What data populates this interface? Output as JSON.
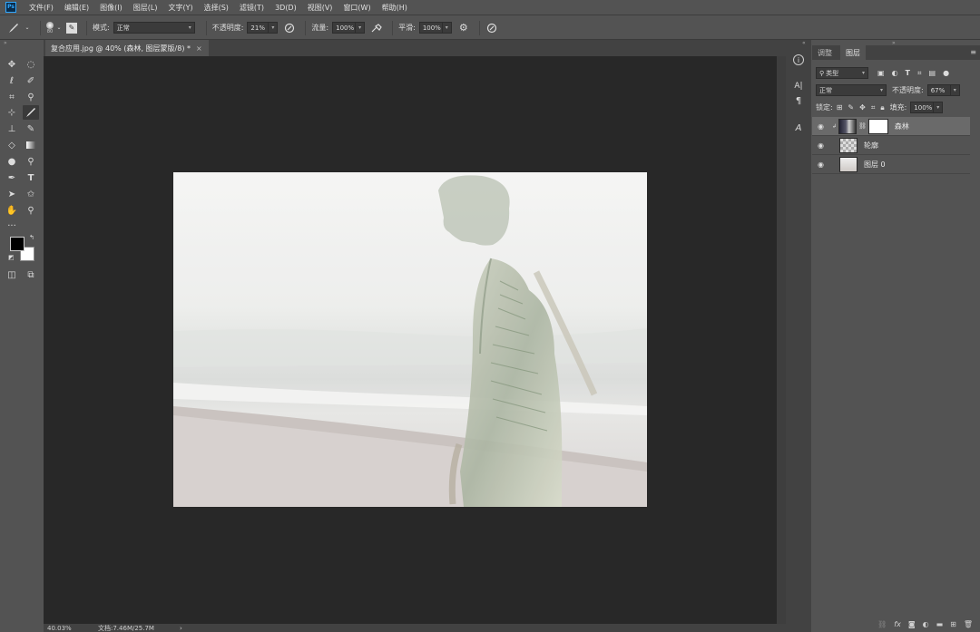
{
  "app": {
    "logo": "Ps"
  },
  "menu": [
    "文件(F)",
    "编辑(E)",
    "图像(I)",
    "图层(L)",
    "文字(Y)",
    "选择(S)",
    "滤镜(T)",
    "3D(D)",
    "视图(V)",
    "窗口(W)",
    "帮助(H)"
  ],
  "options": {
    "brush_size": "80",
    "mode_label": "模式:",
    "mode_value": "正常",
    "opacity_label": "不透明度:",
    "opacity_value": "21%",
    "flow_label": "流量:",
    "flow_value": "100%",
    "smooth_label": "平滑:",
    "smooth_value": "100%"
  },
  "document": {
    "tab_title": "复合应用.jpg @ 40% (森林, 图层蒙版/8) *",
    "close": "×"
  },
  "status": {
    "zoom": "40.03%",
    "doc_info": "文档:7.46M/25.7M",
    "arrow": "›"
  },
  "panels": {
    "tabs": [
      "调整",
      "图层"
    ],
    "active_tab": "图层",
    "filter_kind": "类型",
    "blend_mode": "正常",
    "opacity_label": "不透明度:",
    "opacity_value": "67%",
    "lock_label": "锁定:",
    "fill_label": "填充:",
    "fill_value": "100%",
    "layers": [
      {
        "name": "森林",
        "selected": true,
        "has_mask": true
      },
      {
        "name": "轮廓",
        "selected": false,
        "has_mask": false
      },
      {
        "name": "图层 0",
        "selected": false,
        "has_mask": false
      }
    ]
  },
  "colors": {
    "foreground": "#000000",
    "background": "#ffffff",
    "canvas_bg": "#282828",
    "ui_bg": "#535353"
  },
  "icons": {
    "tools": [
      "move-icon",
      "marquee-icon",
      "lasso-icon",
      "quick-select-icon",
      "crop-icon",
      "eyedropper-icon",
      "healing-icon",
      "brush-icon",
      "stamp-icon",
      "history-brush-icon",
      "eraser-icon",
      "gradient-icon",
      "blur-icon",
      "dodge-icon",
      "pen-icon",
      "type-icon",
      "path-select-icon",
      "shape-icon",
      "hand-icon",
      "zoom-icon",
      "more-tools-icon",
      "swap-colors-icon",
      "default-colors-icon",
      "quick-mask-icon",
      "screen-mode-icon"
    ]
  }
}
